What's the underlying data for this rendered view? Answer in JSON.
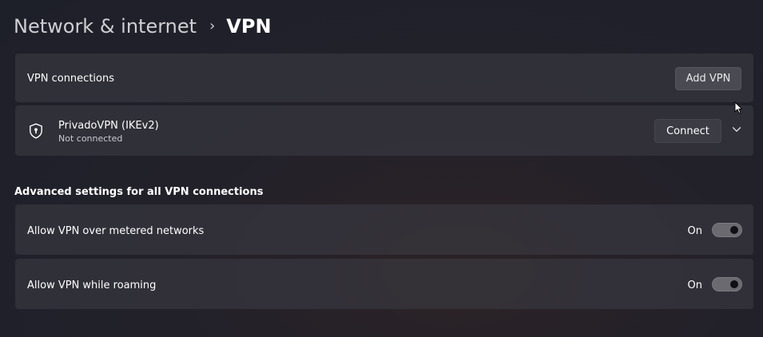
{
  "breadcrumb": {
    "parent": "Network & internet",
    "separator": "›",
    "current": "VPN"
  },
  "vpn_connections": {
    "label": "VPN connections",
    "add_button_label": "Add VPN"
  },
  "connections": [
    {
      "name": "PrivadoVPN (IKEv2)",
      "status": "Not connected",
      "connect_label": "Connect",
      "icon": "shield-icon"
    }
  ],
  "advanced": {
    "title": "Advanced settings for all VPN connections",
    "settings": [
      {
        "label": "Allow VPN over metered networks",
        "state": "On",
        "enabled": true
      },
      {
        "label": "Allow VPN while roaming",
        "state": "On",
        "enabled": true
      }
    ]
  },
  "colors": {
    "background": "#22212a",
    "card": "#3a3a42",
    "toggle_track": "#6a6a70"
  }
}
